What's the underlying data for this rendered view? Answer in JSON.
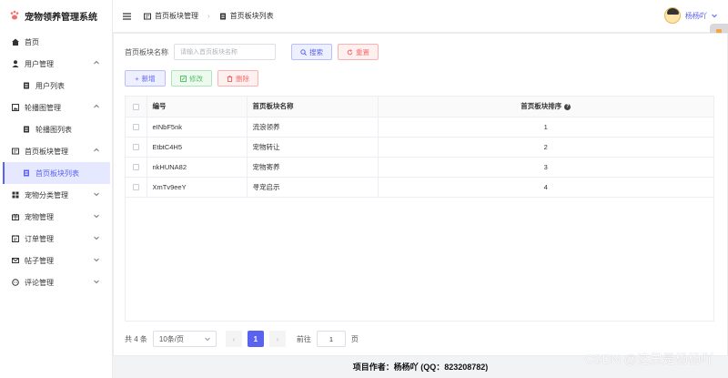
{
  "app": {
    "title": "宠物领养管理系统"
  },
  "sidebar": {
    "items": [
      {
        "label": "首页",
        "icon": "home-icon"
      },
      {
        "label": "用户管理",
        "icon": "user-icon",
        "expanded": true
      },
      {
        "label": "用户列表",
        "icon": "list-icon",
        "sub": true
      },
      {
        "label": "轮播图管理",
        "icon": "image-icon",
        "expanded": true
      },
      {
        "label": "轮播图列表",
        "icon": "list-icon",
        "sub": true
      },
      {
        "label": "首页板块管理",
        "icon": "panel-icon",
        "expanded": true
      },
      {
        "label": "首页板块列表",
        "icon": "list-icon",
        "sub": true,
        "active": true
      },
      {
        "label": "宠物分类管理",
        "icon": "grid-icon"
      },
      {
        "label": "宠物管理",
        "icon": "pet-icon"
      },
      {
        "label": "订单管理",
        "icon": "order-icon"
      },
      {
        "label": "帖子管理",
        "icon": "mail-icon"
      },
      {
        "label": "评论管理",
        "icon": "comment-icon"
      }
    ]
  },
  "header": {
    "breadcrumb": [
      "首页板块管理",
      "首页板块列表"
    ],
    "username": "杨杨吖"
  },
  "search": {
    "label": "首页板块名称",
    "placeholder": "请输入首页板块名称",
    "search_label": "搜索",
    "reset_label": "重置"
  },
  "actions": {
    "add": "新增",
    "edit": "修改",
    "delete": "删除"
  },
  "table": {
    "headers": [
      "编号",
      "首页板块名称",
      "首页板块排序"
    ],
    "rows": [
      [
        "eINbF5nk",
        "流浪领养",
        "1"
      ],
      [
        "EtbtC4H5",
        "宠物转让",
        "2"
      ],
      [
        "nkHUNA82",
        "宠物寄养",
        "3"
      ],
      [
        "XmTv9eeY",
        "寻宠启示",
        "4"
      ]
    ]
  },
  "pagination": {
    "total": "共 4 条",
    "page_size": "10条/页",
    "current_page": "1",
    "goto_prefix": "前往",
    "goto_value": "1",
    "goto_suffix": "页"
  },
  "footer": "项目作者：杨杨吖 (QQ：823208782)",
  "watermark": "CSDN @这里是杨杨吖",
  "colors": {
    "accent": "#5a63f0",
    "success": "#59c36a",
    "danger": "#f56c6c"
  }
}
